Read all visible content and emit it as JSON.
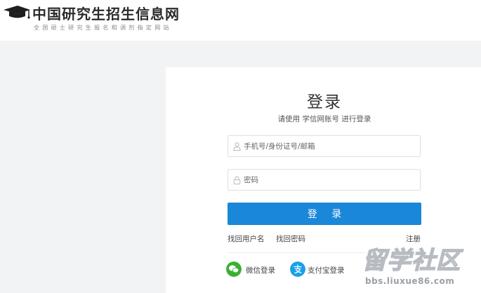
{
  "header": {
    "title": "中国研究生招生信息网",
    "subtitle": "全国硕士研究生报名和调剂指定网站"
  },
  "login": {
    "title": "登录",
    "subtitle": "请使用 学信网账号 进行登录",
    "username_placeholder": "手机号/身份证号/邮箱",
    "password_placeholder": "密码",
    "submit_label": "登 录",
    "find_username": "找回用户名",
    "find_password": "找回密码",
    "register": "注册",
    "wechat_login": "微信登录",
    "alipay_login": "支付宝登录"
  },
  "watermark": {
    "big": "留学社区",
    "small": "bbs.liuxue86.com"
  },
  "colors": {
    "primary": "#1b87d9",
    "wechat": "#3cb034",
    "alipay": "#1aa0e8",
    "background": "#f2f3f5"
  },
  "icons": {
    "logo": "graduation-cap-icon",
    "username": "user-icon",
    "password": "lock-icon",
    "wechat": "wechat-icon",
    "alipay": "alipay-icon"
  }
}
